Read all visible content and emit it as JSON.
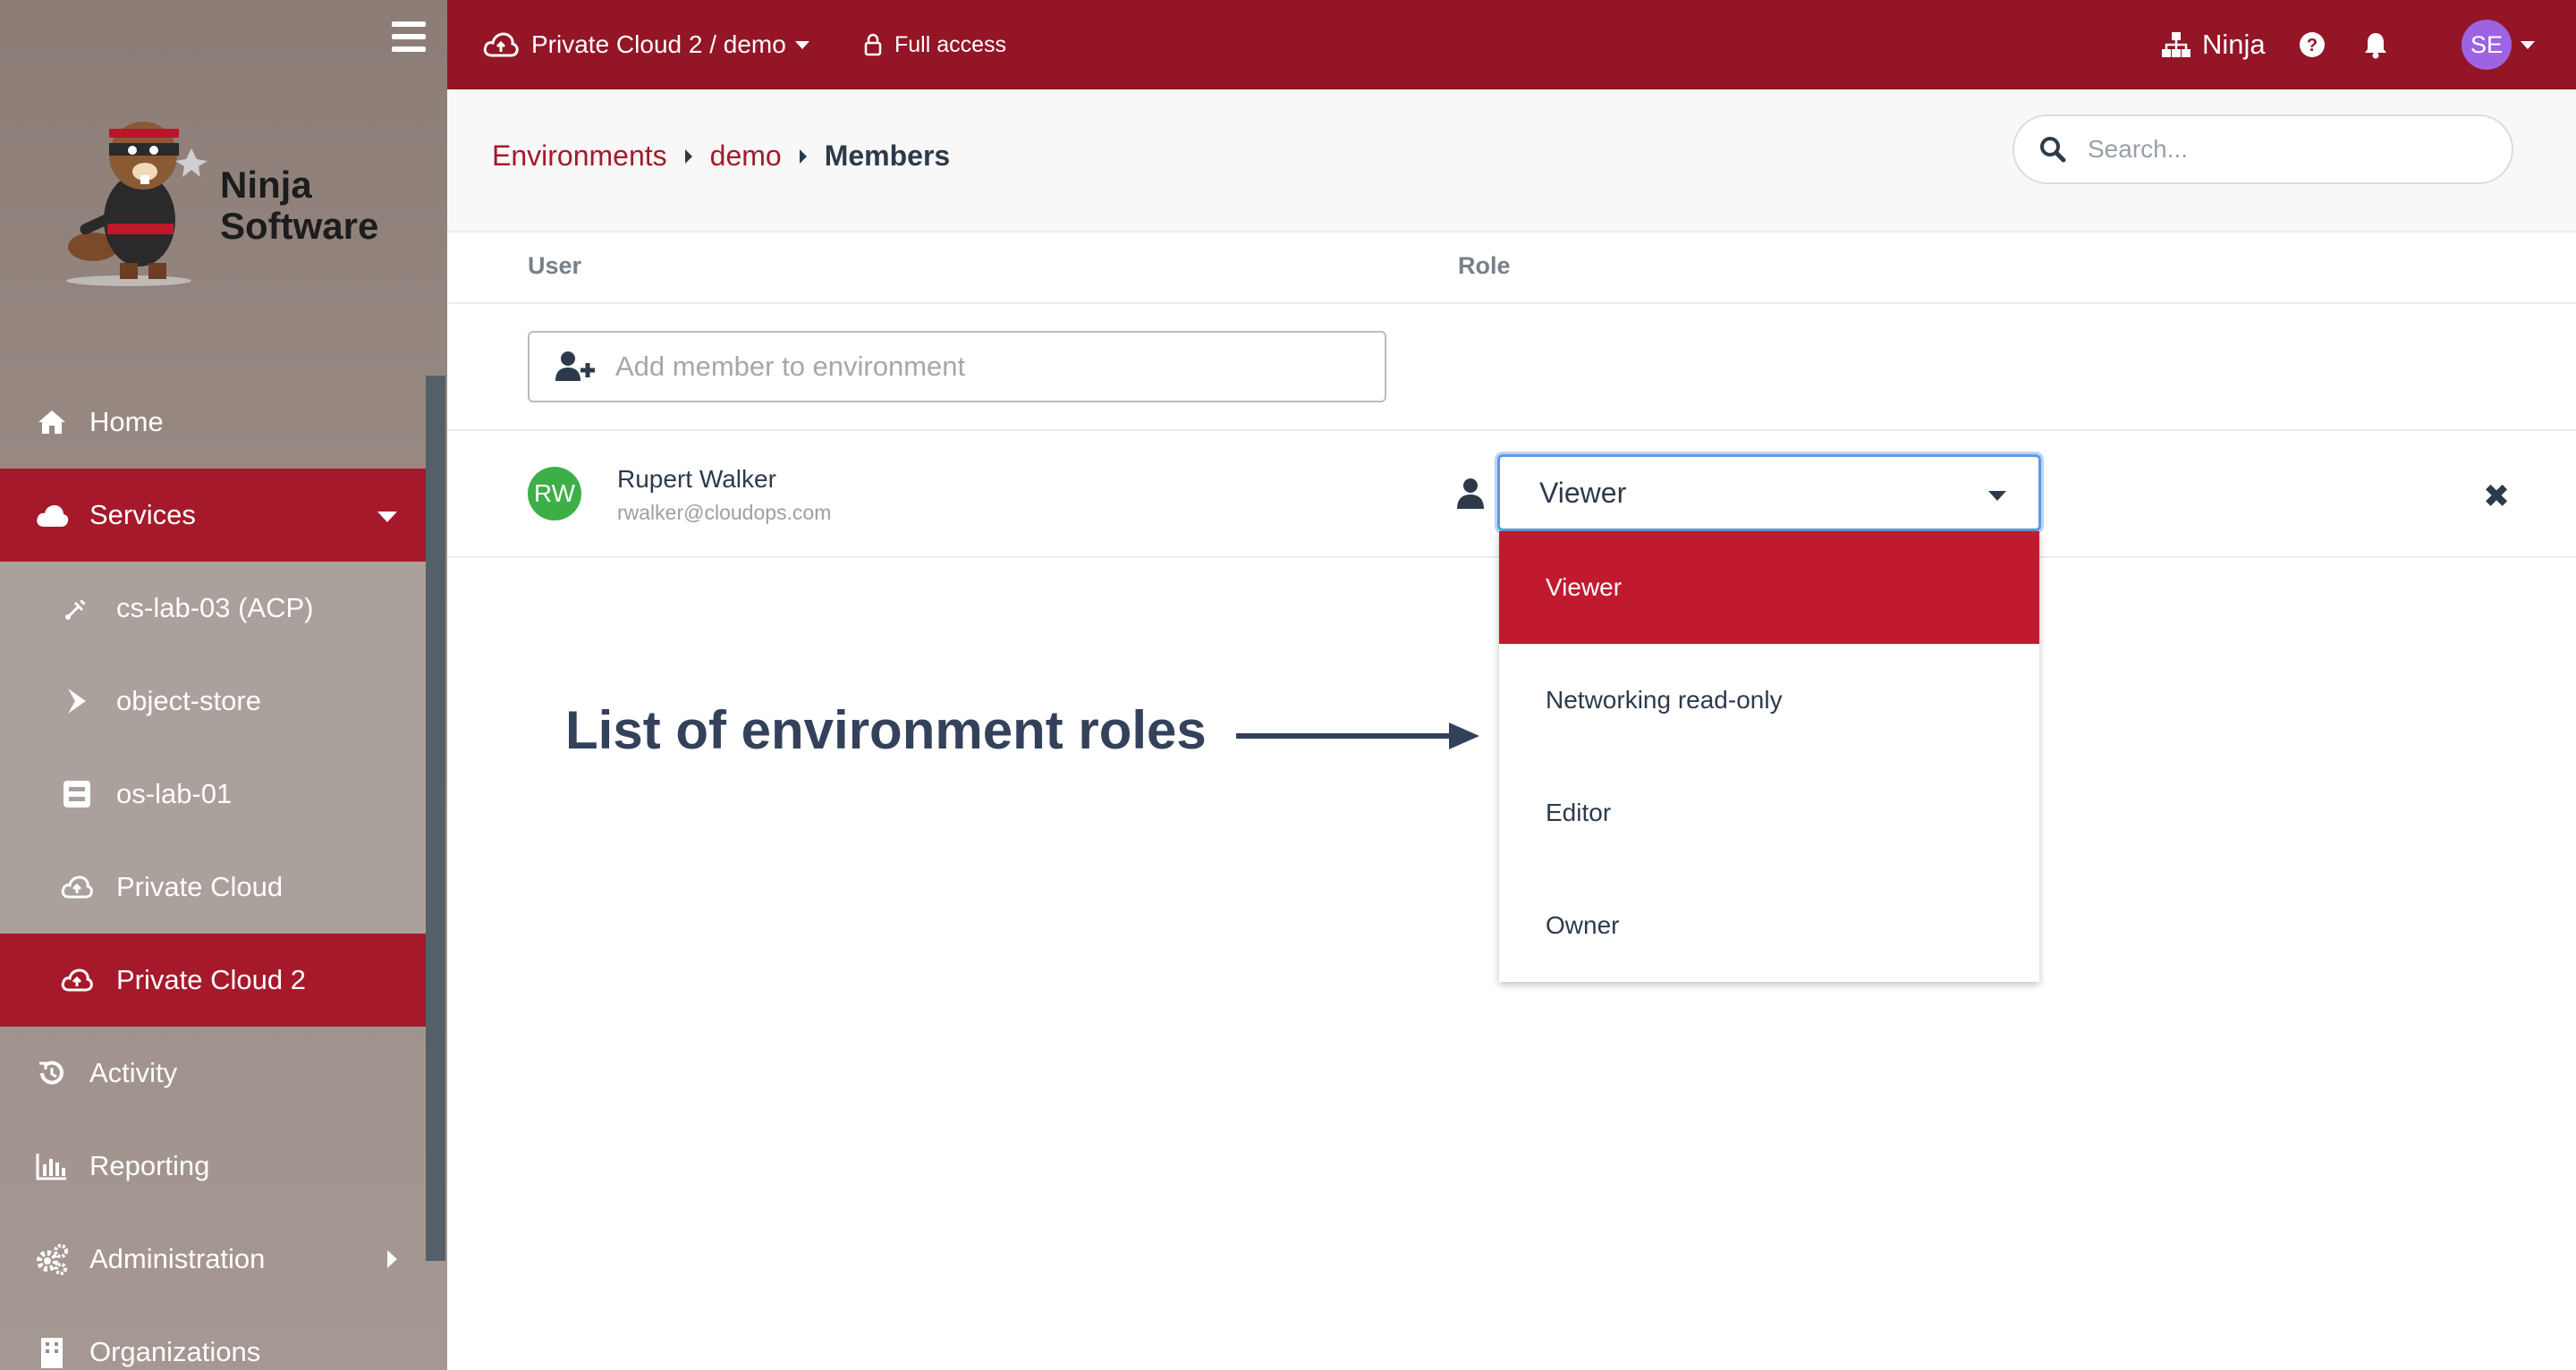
{
  "sidebar": {
    "logo_text_line1": "Ninja",
    "logo_text_line2": "Software",
    "items": [
      {
        "label": "Home",
        "icon": "home-icon"
      },
      {
        "label": "Services",
        "icon": "cloud-icon"
      },
      {
        "label": "cs-lab-03 (ACP)",
        "icon": "satellite-icon"
      },
      {
        "label": "object-store",
        "icon": "arrow-icon"
      },
      {
        "label": "os-lab-01",
        "icon": "server-icon"
      },
      {
        "label": "Private Cloud",
        "icon": "cloud-upload-icon"
      },
      {
        "label": "Private Cloud 2",
        "icon": "cloud-upload-icon"
      },
      {
        "label": "Activity",
        "icon": "history-icon"
      },
      {
        "label": "Reporting",
        "icon": "bar-chart-icon"
      },
      {
        "label": "Administration",
        "icon": "gears-icon"
      },
      {
        "label": "Organizations",
        "icon": "building-icon"
      }
    ]
  },
  "topbar": {
    "environment": "Private Cloud 2 / demo",
    "access": "Full access",
    "org": "Ninja",
    "user_initials": "SE"
  },
  "breadcrumb": {
    "items": [
      "Environments",
      "demo",
      "Members"
    ]
  },
  "search": {
    "placeholder": "Search..."
  },
  "table": {
    "col_user": "User",
    "col_role": "Role",
    "add_member_placeholder": "Add member to environment"
  },
  "member": {
    "initials": "RW",
    "name": "Rupert Walker",
    "email": "rwalker@cloudops.com",
    "role": "Viewer"
  },
  "roles_dropdown": {
    "options": [
      "Viewer",
      "Networking read-only",
      "Editor",
      "Owner"
    ],
    "selected": "Viewer"
  },
  "annotation": {
    "text": "List of environment roles"
  },
  "colors": {
    "brand": "#931526",
    "active": "#a5192b",
    "selected_option": "#c11a2f",
    "avatar_user": "#9d63e3",
    "avatar_member": "#3daf47"
  }
}
